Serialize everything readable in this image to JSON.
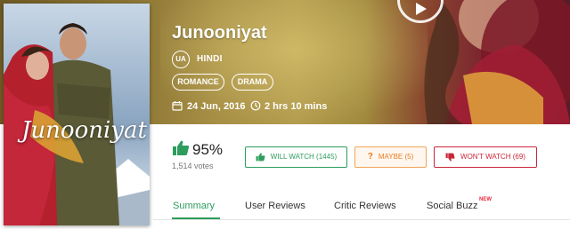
{
  "movie": {
    "title": "Junooniyat",
    "certificate": "UA",
    "language": "HINDI",
    "genres": [
      "ROMANCE",
      "DRAMA"
    ],
    "release_date": "24 Jun, 2016",
    "runtime": "2 hrs 10 mins",
    "poster_title": "Junooniyat"
  },
  "rating": {
    "percent": "95%",
    "votes": "1,514 votes"
  },
  "actions": {
    "will_watch": "WILL WATCH (1445)",
    "maybe": "MAYBE (5)",
    "wont_watch": "WON'T WATCH (69)"
  },
  "tabs": [
    {
      "label": "Summary",
      "active": true
    },
    {
      "label": "User Reviews",
      "active": false
    },
    {
      "label": "Critic Reviews",
      "active": false
    },
    {
      "label": "Social Buzz",
      "active": false,
      "badge": "NEW"
    }
  ],
  "icons": {
    "play": "play-icon",
    "calendar": "calendar-icon",
    "clock": "clock-icon",
    "thumbs_up": "thumbs-up-icon",
    "question": "question-icon",
    "thumbs_down": "thumbs-down-icon"
  },
  "colors": {
    "accent_green": "#2d9d5d",
    "maybe_orange": "#e87a22",
    "wont_red": "#c9263a"
  }
}
